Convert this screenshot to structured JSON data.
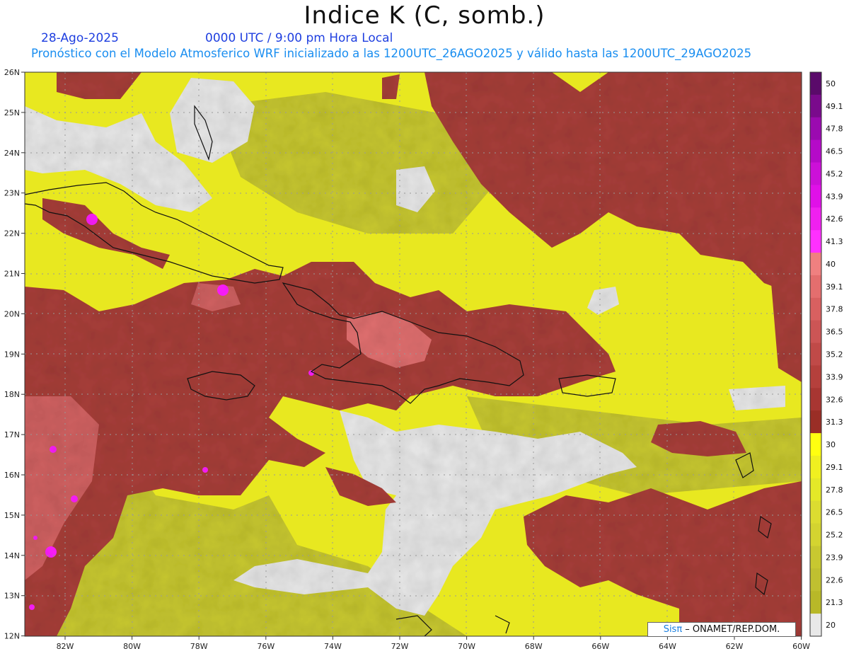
{
  "title": "Indice K (C, somb.)",
  "date": "28-Ago-2025",
  "time": "0000 UTC / 9:00 pm Hora Local",
  "forecast": "Pronóstico con el Modelo Atmosferico WRF inicializado a las 1200UTC_26AGO2025 y válido hasta las  1200UTC_29AGO2025",
  "credit": {
    "brand": "Sisπ",
    "rest": " – ONAMET/REP.DOM."
  },
  "axes": {
    "lat_labels": [
      "26N",
      "25N",
      "24N",
      "23N",
      "22N",
      "21N",
      "20N",
      "19N",
      "18N",
      "17N",
      "16N",
      "15N",
      "14N",
      "13N",
      "12N"
    ],
    "lon_labels": [
      "82W",
      "80W",
      "78W",
      "76W",
      "74W",
      "72W",
      "70W",
      "68W",
      "66W",
      "64W",
      "62W",
      "60W"
    ]
  },
  "colorbar": {
    "levels": [
      "50",
      "49.1",
      "47.8",
      "46.5",
      "45.2",
      "43.9",
      "42.6",
      "41.3",
      "40",
      "39.1",
      "37.8",
      "36.5",
      "35.2",
      "33.9",
      "32.6",
      "31.3",
      "30",
      "29.1",
      "27.8",
      "26.5",
      "25.2",
      "23.9",
      "22.6",
      "21.3",
      "20"
    ],
    "colors": [
      "#5a0a6a",
      "#7a0a8c",
      "#9b0ab0",
      "#b50ac8",
      "#cc10d8",
      "#e010e8",
      "#f020f0",
      "#ff30ff",
      "#f08080",
      "#e46e6e",
      "#d86060",
      "#cc5555",
      "#c04a48",
      "#b5403c",
      "#a83632",
      "#9a2e26",
      "#ffff10",
      "#f0f020",
      "#e4e828",
      "#dcdc30",
      "#d4d430",
      "#c8c830",
      "#c0c030",
      "#b8b828",
      "#e8e8e8"
    ]
  },
  "colors": {
    "dry": "#e8e8e8",
    "yellow": "#e8e820",
    "brown": "#a8403a",
    "pink": "#e07070",
    "magenta": "#ff20ff"
  }
}
